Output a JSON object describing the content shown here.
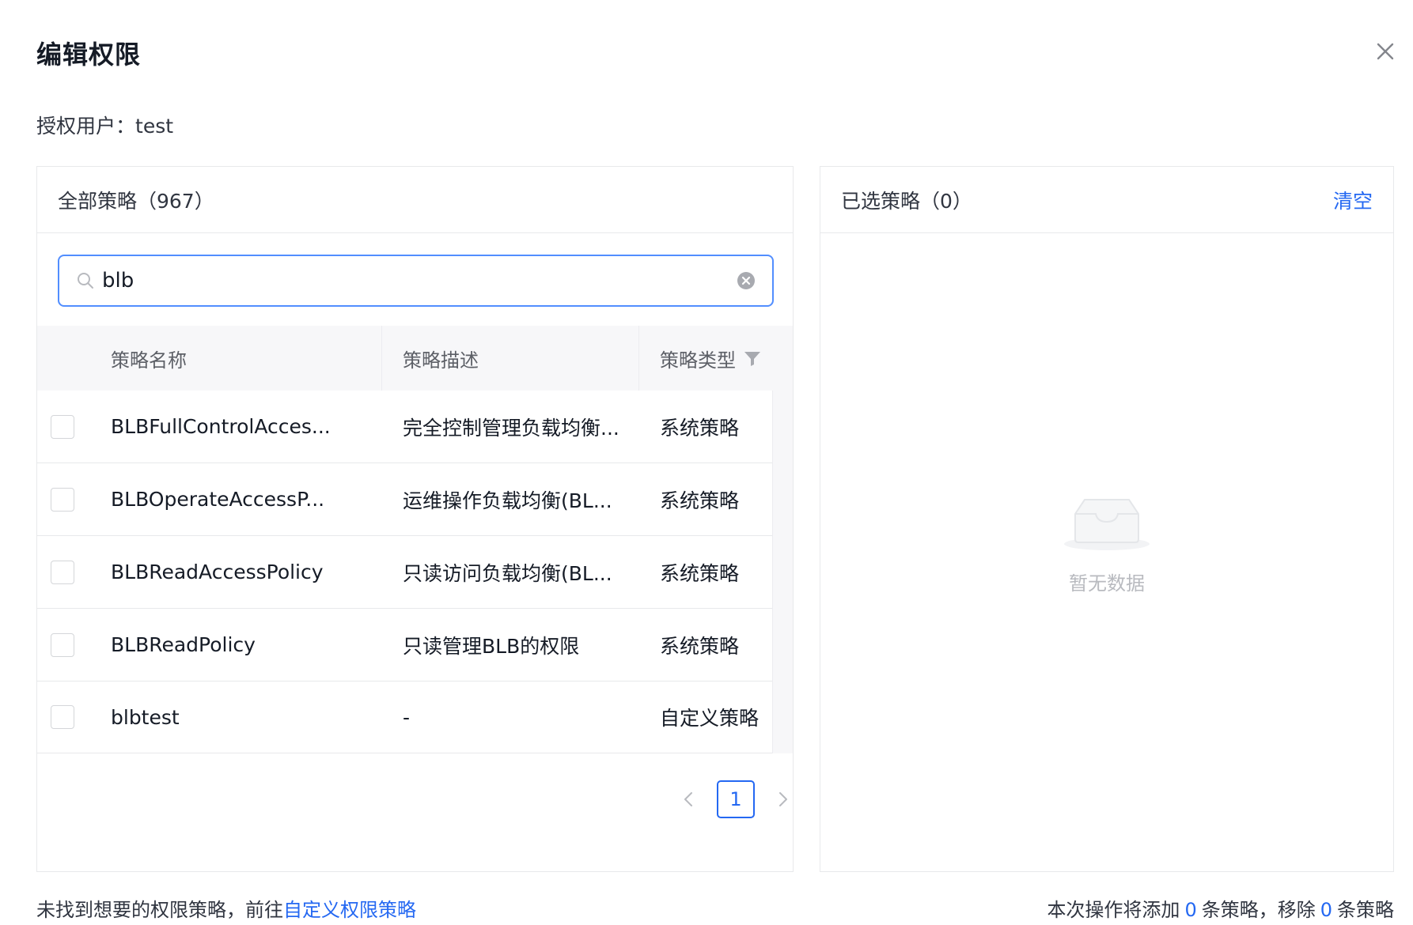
{
  "modal": {
    "title": "编辑权限",
    "grant_user_label": "授权用户：",
    "grant_user_value": "test"
  },
  "left_panel": {
    "title": "全部策略（967）",
    "search": {
      "value": "blb",
      "placeholder": ""
    },
    "columns": [
      "策略名称",
      "策略描述",
      "策略类型"
    ],
    "rows": [
      {
        "name": "BLBFullControlAcces...",
        "desc": "完全控制管理负载均衡...",
        "type": "系统策略"
      },
      {
        "name": "BLBOperateAccessP...",
        "desc": "运维操作负载均衡(BL...",
        "type": "系统策略"
      },
      {
        "name": "BLBReadAccessPolicy",
        "desc": "只读访问负载均衡(BL...",
        "type": "系统策略"
      },
      {
        "name": "BLBReadPolicy",
        "desc": "只读管理BLB的权限",
        "type": "系统策略"
      },
      {
        "name": "blbtest",
        "desc": "-",
        "type": "自定义策略"
      }
    ],
    "pagination": {
      "current_page": "1"
    }
  },
  "right_panel": {
    "title": "已选策略（0）",
    "clear_label": "清空",
    "empty_text": "暂无数据"
  },
  "footer": {
    "left_text": "未找到想要的权限策略，前往",
    "left_link": "自定义权限策略",
    "right_prefix": "本次操作将添加",
    "add_count": "0",
    "right_middle": "条策略，移除",
    "remove_count": "0",
    "right_suffix": "条策略"
  },
  "icons": {
    "close": "close-icon",
    "search": "search-icon",
    "clear": "clear-input-icon",
    "filter": "filter-icon",
    "empty": "empty-inbox-icon"
  },
  "colors": {
    "accent": "#2468f2",
    "search_border": "#528eff",
    "border": "#e8e9eb",
    "header_bg": "#f7f7f9"
  }
}
